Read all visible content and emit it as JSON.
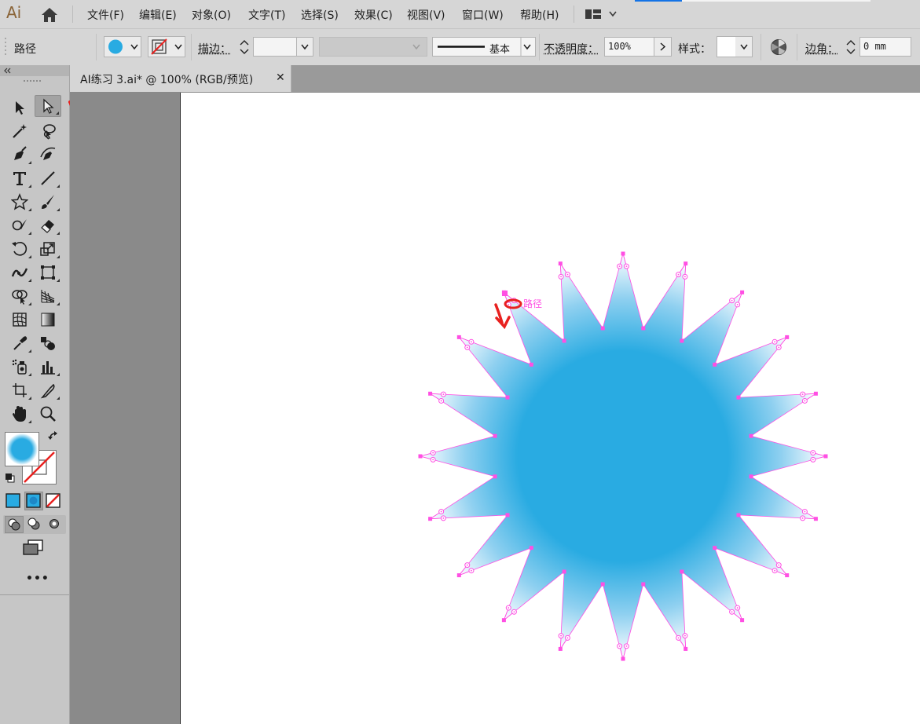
{
  "app": {
    "logo": "Ai"
  },
  "menu": [
    {
      "label": "文件(F)"
    },
    {
      "label": "编辑(E)"
    },
    {
      "label": "对象(O)"
    },
    {
      "label": "文字(T)"
    },
    {
      "label": "选择(S)"
    },
    {
      "label": "效果(C)"
    },
    {
      "label": "视图(V)"
    },
    {
      "label": "窗口(W)"
    },
    {
      "label": "帮助(H)"
    }
  ],
  "control_bar": {
    "selection_type": "路径",
    "fill_color": "#29abe2",
    "stroke_color": "none",
    "stroke_label": "描边：",
    "stroke_weight": "",
    "stroke_profile": "基本",
    "opacity_label": "不透明度：",
    "opacity_value": "100%",
    "style_label": "样式：",
    "corner_label": "边角：",
    "corner_value": "0 mm"
  },
  "document": {
    "tab_title": "AI练习 3.ai* @ 100% (RGB/预览)",
    "tab_close": "✕"
  },
  "canvas": {
    "hover_label": "路径",
    "shape": {
      "type": "starburst",
      "points": 20,
      "fill": "#29abe2",
      "gradient_tip": "#ffffff",
      "path_color": "#ff4fe3"
    }
  },
  "colors": {
    "accent": "#1473e6",
    "annotation": "#e8211f"
  },
  "toolbar": {
    "tools": [
      "selection-tool",
      "direct-selection-tool",
      "magic-wand-tool",
      "lasso-tool",
      "pen-tool",
      "curvature-tool",
      "type-tool",
      "line-segment-tool",
      "star-tool",
      "paintbrush-tool",
      "shaper-tool",
      "eraser-tool",
      "rotate-tool",
      "scale-tool",
      "width-tool",
      "free-transform-tool",
      "shape-builder-tool",
      "perspective-grid-tool",
      "mesh-tool",
      "gradient-tool",
      "eyedropper-tool",
      "blend-tool",
      "symbol-sprayer-tool",
      "column-graph-tool",
      "artboard-tool",
      "slice-tool",
      "hand-tool",
      "zoom-tool"
    ],
    "active_tool": "direct-selection-tool",
    "more": "•••"
  }
}
